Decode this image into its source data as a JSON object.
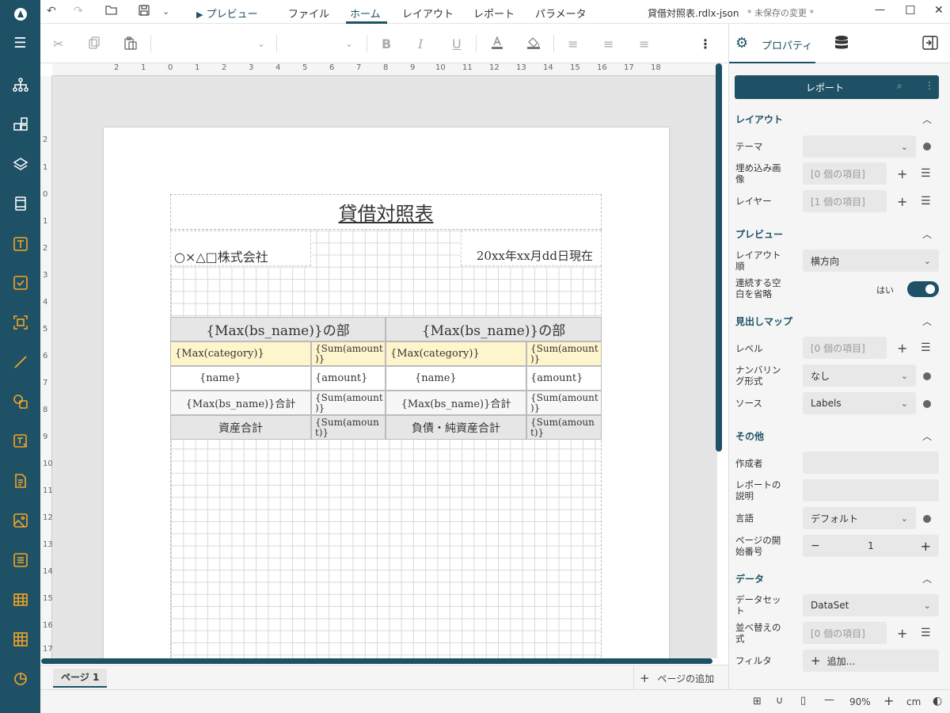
{
  "window": {
    "title": "貸借対照表.rdlx-json",
    "unsaved": "* 未保存の変更 *",
    "min": "—",
    "max": "☐",
    "close": "✕"
  },
  "topbar": {
    "preview": "プレビュー",
    "menus": [
      "ファイル",
      "ホーム",
      "レイアウト",
      "レポート",
      "パラメータ"
    ]
  },
  "rail_icons": [
    "logo-icon",
    "hamburger-icon",
    "hierarchy-icon",
    "components-icon",
    "layers-icon",
    "page-icon",
    "textbox-icon",
    "checkbox-icon",
    "shape-select-icon",
    "line-icon",
    "shapes-icon",
    "input-field-icon",
    "richtext-icon",
    "image-icon",
    "list-icon",
    "table-icon",
    "tablix-icon",
    "chart-icon"
  ],
  "hruler": [
    "2",
    "1",
    "0",
    "1",
    "2",
    "3",
    "4",
    "5",
    "6",
    "7",
    "8",
    "9",
    "10",
    "11",
    "12",
    "13",
    "14",
    "15",
    "16",
    "17",
    "18"
  ],
  "vruler": [
    "2",
    "1",
    "0",
    "1",
    "2",
    "3",
    "4",
    "5",
    "6",
    "7",
    "8",
    "9",
    "10",
    "11",
    "12",
    "13",
    "14",
    "15",
    "16",
    "17"
  ],
  "report": {
    "title": "貸借対照表",
    "company": "○×△□株式会社",
    "date": "20xx年xx月dd日現在",
    "header_left": "{Max(bs_name)}の部",
    "header_right": "{Max(bs_name)}の部",
    "category_left": "{Max(category)}",
    "sum_left": "{Sum(amount",
    "sum_left2": ")}",
    "category_right": "{Max(category)}",
    "sum_right": "{Sum(amount",
    "sum_right2": ")}",
    "name_left": "{name}",
    "amount_left": "{amount}",
    "name_right": "{name}",
    "amount_right": "{amount}",
    "subtotal_left": "{Max(bs_name)}合計",
    "subsum_left": "{Sum(amount",
    "subsum_left2": ")}",
    "subtotal_right": "{Max(bs_name)}合計",
    "subsum_right": "{Sum(amount",
    "subsum_right2": ")}",
    "total_left": "資産合計",
    "totsum_left": "{Sum(amoun",
    "totsum_left2": "t)}",
    "total_right": "負債・純資産合計",
    "totsum_right": "{Sum(amoun",
    "totsum_right2": "t)}"
  },
  "pagebar": {
    "tab": "ページ 1",
    "add": "ページの追加"
  },
  "status": {
    "zoom": "90%",
    "unit": "cm",
    "minus": "—",
    "plus": "+"
  },
  "panel": {
    "tab_props": "プロパティ",
    "report_button": "レポート",
    "sections": {
      "layout": "レイアウト",
      "preview": "プレビュー",
      "docmap": "見出しマップ",
      "other": "その他",
      "data": "データ"
    },
    "fields": {
      "theme_label": "テーマ",
      "theme_value": "",
      "embedded_label": "埋め込み画像",
      "embedded_value": "[0 個の項目]",
      "layers_label": "レイヤー",
      "layers_value": "[1 個の項目]",
      "layout_order_label": "レイアウト順",
      "layout_order_value": "横方向",
      "collapse_label": "連続する空白を省略",
      "collapse_value": "はい",
      "level_label": "レベル",
      "level_value": "[0 個の項目]",
      "numbering_label": "ナンバリング形式",
      "numbering_value": "なし",
      "source_label": "ソース",
      "source_value": "Labels",
      "author_label": "作成者",
      "author_value": "",
      "desc_label": "レポートの説明",
      "desc_value": "",
      "lang_label": "言語",
      "lang_value": "デフォルト",
      "startpage_label": "ページの開始番号",
      "startpage_value": "1",
      "dataset_label": "データセット",
      "dataset_value": "DataSet",
      "sort_label": "並べ替えの式",
      "sort_value": "[0 個の項目]",
      "filter_label": "フィルタ",
      "filter_value": "追加..."
    }
  }
}
